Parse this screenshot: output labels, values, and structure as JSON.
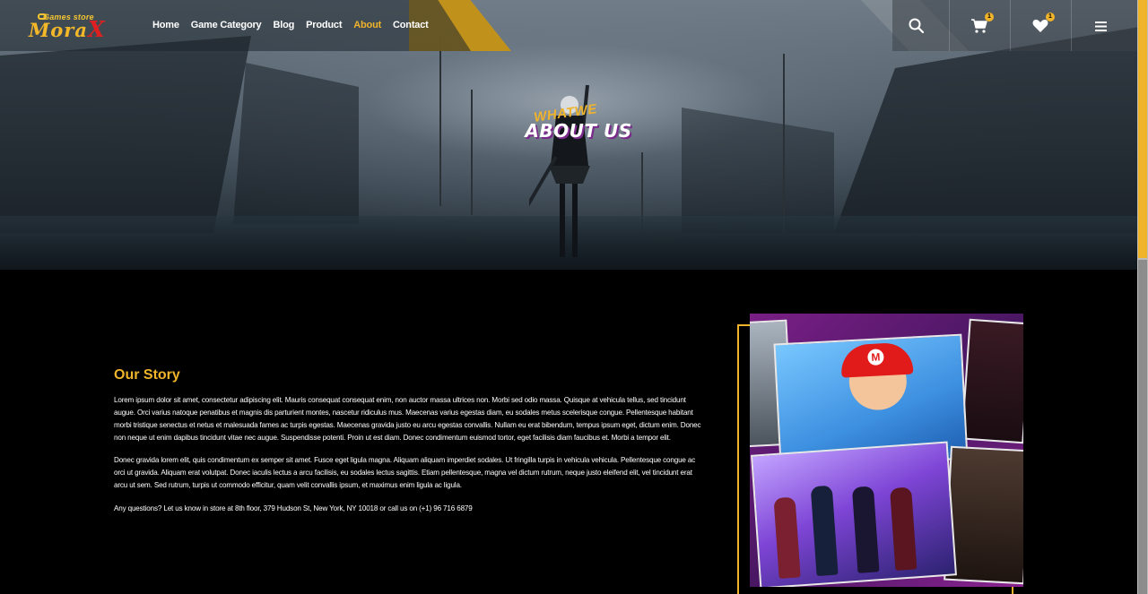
{
  "brand": {
    "logo_top": "Games store",
    "logo_main": "Mora",
    "logo_x": "X"
  },
  "nav": {
    "items": [
      {
        "label": "Home",
        "active": false
      },
      {
        "label": "Game Category",
        "active": false
      },
      {
        "label": "Blog",
        "active": false
      },
      {
        "label": "Product",
        "active": false
      },
      {
        "label": "About",
        "active": true
      },
      {
        "label": "Contact",
        "active": false
      }
    ],
    "icons": {
      "search": "search-icon",
      "cart": "cart-icon",
      "wishlist": "heart-icon",
      "menu": "menu-icon"
    },
    "cart_count": "1",
    "wishlist_count": "1"
  },
  "hero": {
    "subtitle": "WHATWE",
    "title": "ABOUT US"
  },
  "story": {
    "title": "Our Story",
    "paragraphs": [
      "Lorem ipsum dolor sit amet, consectetur adipiscing elit. Mauris consequat consequat enim, non auctor massa ultrices non. Morbi sed odio massa. Quisque at vehicula tellus, sed tincidunt augue. Orci varius natoque penatibus et magnis dis parturient montes, nascetur ridiculus mus. Maecenas varius egestas diam, eu sodales metus scelerisque congue. Pellentesque habitant morbi tristique senectus et netus et malesuada fames ac turpis egestas. Maecenas gravida justo eu arcu egestas convallis. Nullam eu erat bibendum, tempus ipsum eget, dictum enim. Donec non neque ut enim dapibus tincidunt vitae nec augue. Suspendisse potenti. Proin ut est diam. Donec condimentum euismod tortor, eget facilisis diam faucibus et. Morbi a tempor elit.",
      "Donec gravida lorem elit, quis condimentum ex semper sit amet. Fusce eget ligula magna. Aliquam aliquam imperdiet sodales. Ut fringilla turpis in vehicula vehicula. Pellentesque congue ac orci ut gravida. Aliquam erat volutpat. Donec iaculis lectus a arcu facilisis, eu sodales lectus sagittis. Etiam pellentesque, magna vel dictum rutrum, neque justo eleifend elit, vel tincidunt erat arcu ut sem. Sed rutrum, turpis ut commodo efficitur, quam velit convallis ipsum, et maximus enim ligula ac ligula.",
      "Any questions? Let us know in store at 8th floor, 379 Hudson St, New York, NY 10018 or call us on (+1) 96 716 6879"
    ]
  },
  "colors": {
    "accent": "#f0b42a",
    "background": "#000000",
    "logo_x": "#e02020"
  }
}
